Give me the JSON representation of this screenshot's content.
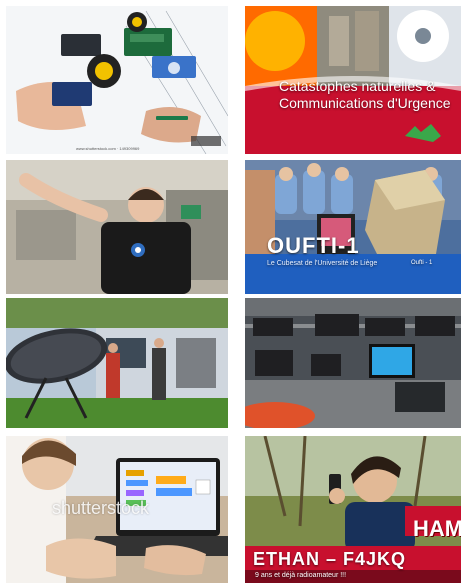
{
  "tiles": {
    "t1": {
      "watermark": "www.shutterstock.com · 149309969"
    },
    "t2": {
      "title": "Catastophes naturelles & Communications d'Urgence"
    },
    "t4": {
      "title": "OUFTI-1",
      "subtitle": "Le Cubesat de l'Université de Liège",
      "logo_text": "Oufti - 1"
    },
    "t7": {
      "watermark": "shutterstock"
    },
    "t8": {
      "tag": "HAM",
      "banner": "ETHAN – F4JKQ",
      "banner_sub": "9 ans et déjà radioamateur !!!"
    }
  },
  "colors": {
    "red_banner": "#c8102e",
    "blue_banner": "#1f5fbf",
    "grass": "#4d8b2f"
  }
}
